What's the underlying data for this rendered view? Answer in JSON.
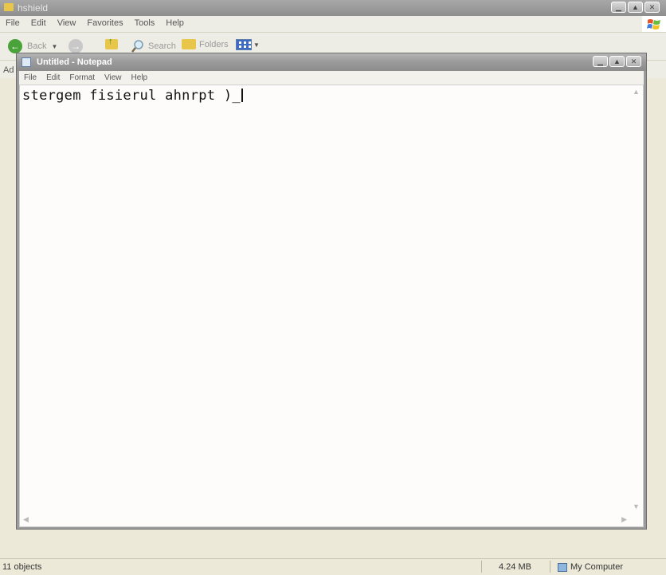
{
  "explorer": {
    "title": "hshield",
    "menu": [
      "File",
      "Edit",
      "View",
      "Favorites",
      "Tools",
      "Help"
    ],
    "toolbar": {
      "back_label": "Back",
      "search_label": "Search",
      "folders_label": "Folders"
    },
    "address_label": "Ad",
    "status": {
      "objects": "11 objects",
      "size": "4.24 MB",
      "location": "My Computer"
    }
  },
  "notepad": {
    "title": "Untitled - Notepad",
    "menu": [
      "File",
      "Edit",
      "Format",
      "View",
      "Help"
    ],
    "text": "stergem fisierul ahnrpt )_"
  },
  "colors": {
    "inactive_title": "#9b9b9b",
    "menubar": "#eeede5",
    "edit_bg": "#fdfcfa"
  }
}
